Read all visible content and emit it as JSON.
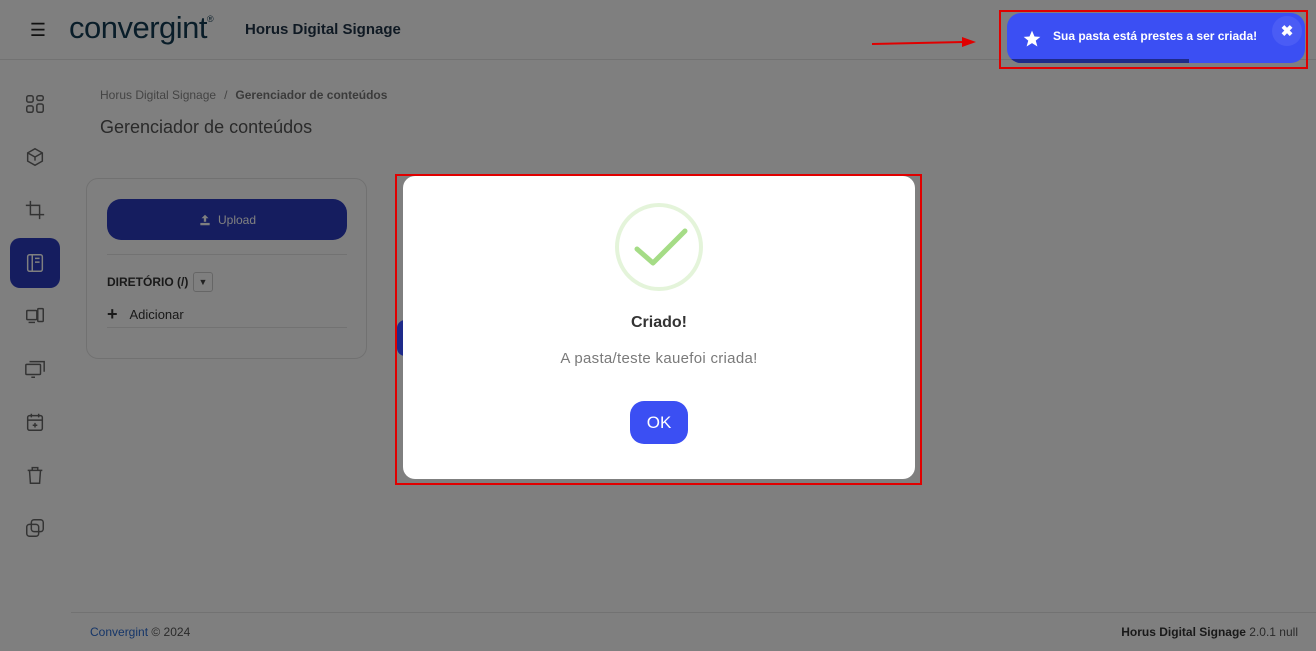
{
  "header": {
    "logo_text": "convergint",
    "logo_mark": "®",
    "app_title": "Horus Digital Signage",
    "menu_icon": "hamburger-icon"
  },
  "sidebar": {
    "items": [
      {
        "icon": "dashboard-icon",
        "active": false
      },
      {
        "icon": "cube-icon",
        "active": false
      },
      {
        "icon": "crop-icon",
        "active": false
      },
      {
        "icon": "content-book-icon",
        "active": true
      },
      {
        "icon": "devices-icon",
        "active": false
      },
      {
        "icon": "monitors-icon",
        "active": false
      },
      {
        "icon": "calendar-add-icon",
        "active": false
      },
      {
        "icon": "trash-icon",
        "active": false
      },
      {
        "icon": "copy-icon",
        "active": false
      }
    ]
  },
  "breadcrumb": {
    "root": "Horus Digital Signage",
    "separator": "/",
    "current": "Gerenciador de conteúdos"
  },
  "page": {
    "title": "Gerenciador de conteúdos"
  },
  "explorer": {
    "upload_label": "Upload",
    "directory_label": "DIRETÓRIO (/)",
    "add_label": "Adicionar"
  },
  "footer": {
    "brand": "Convergint",
    "copyright": " © 2024",
    "product": "Horus Digital Signage",
    "version": " 2.0.1 null"
  },
  "modal": {
    "title": "Criado!",
    "text": "A pasta/teste kauefoi criada!",
    "ok_label": "OK",
    "icon": "success-check-icon"
  },
  "toast": {
    "text": "Sua pasta está prestes a ser criada!",
    "close_label": "✖",
    "icon": "star-icon"
  },
  "colors": {
    "primary": "#2b3bbf",
    "button_blue": "#3b4ff3",
    "annotation_red": "#e00000",
    "success_green": "#a5dc86"
  }
}
